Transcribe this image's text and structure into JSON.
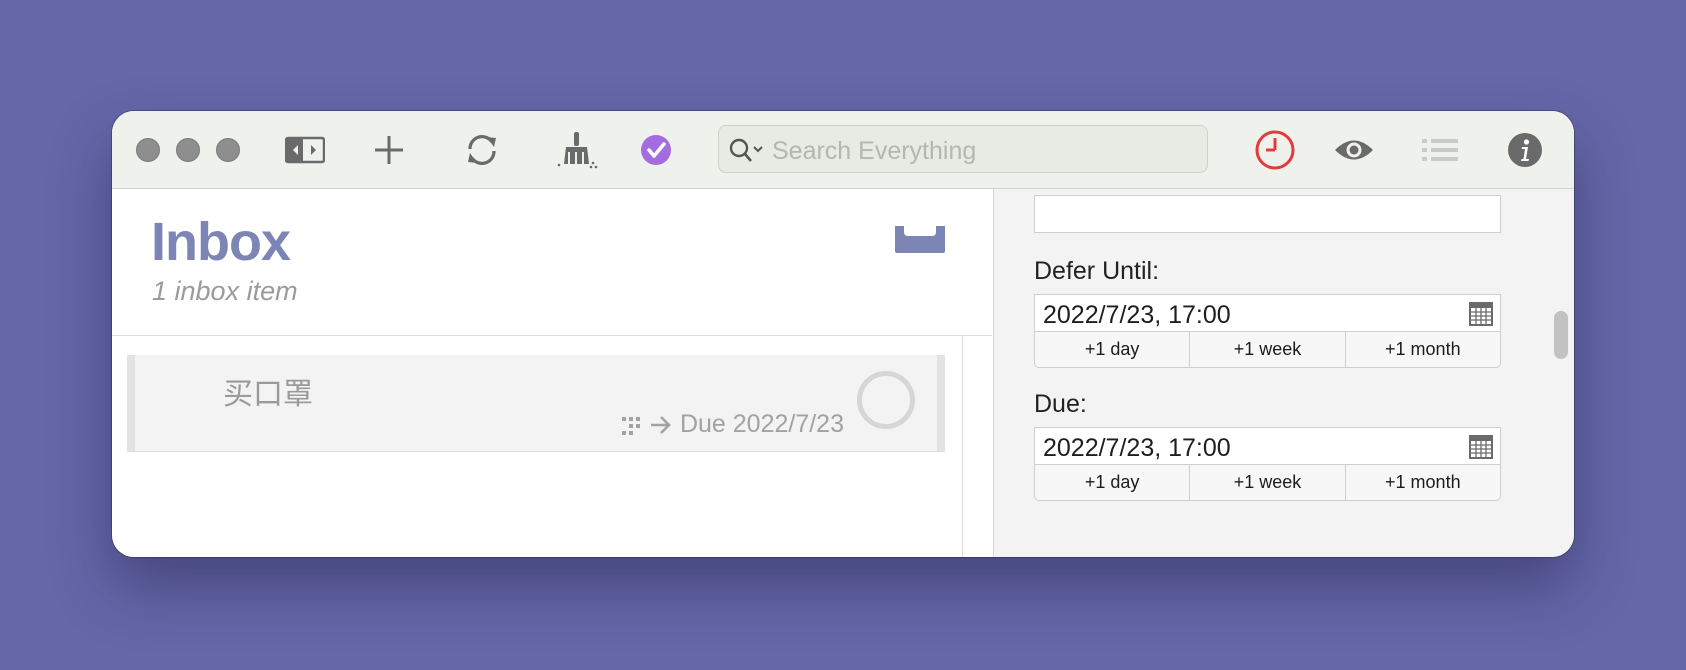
{
  "toolbar": {
    "search_placeholder": "Search Everything"
  },
  "inbox": {
    "title": "Inbox",
    "subtitle": "1 inbox item",
    "items": [
      {
        "title": "买口罩",
        "due_text": "Due 2022/7/23"
      }
    ]
  },
  "inspector": {
    "defer_label": "Defer Until:",
    "defer_value": "2022/7/23, 17:00",
    "due_label": "Due:",
    "due_value": "2022/7/23, 17:00",
    "quick_buttons": [
      "+1 day",
      "+1 week",
      "+1 month"
    ]
  },
  "colors": {
    "background": "#6567a9",
    "accent": "#7d85b5",
    "forecast_red": "#e53a3a",
    "purple_check": "#a56be0"
  },
  "icons": [
    "sidebar-toggle-icon",
    "plus-icon",
    "sync-icon",
    "broom-icon",
    "check-circle-icon",
    "search-icon",
    "forecast-clock-icon",
    "eye-icon",
    "list-icon",
    "info-icon",
    "inbox-tray-icon",
    "drop-icon",
    "arrow-right-icon",
    "calendar-icon"
  ]
}
